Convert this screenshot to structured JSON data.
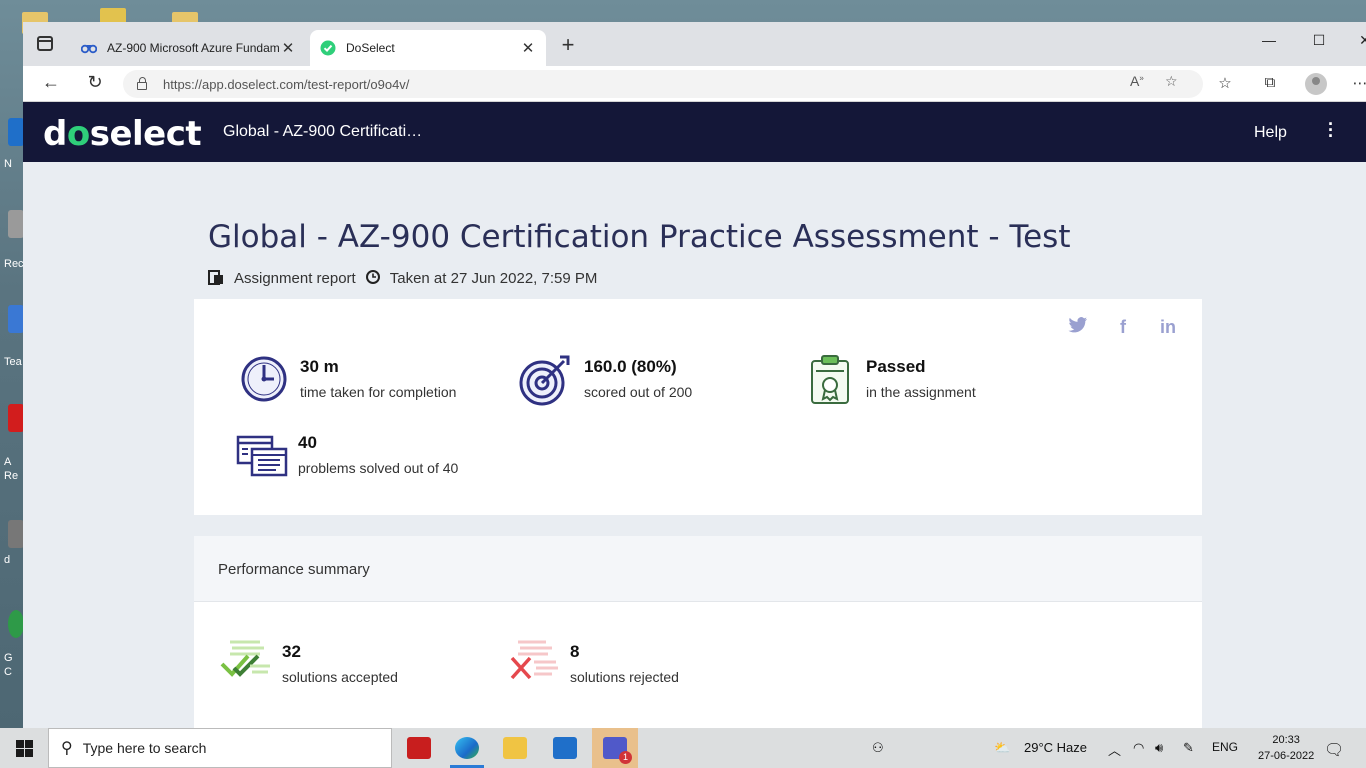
{
  "desktop": {
    "labels": [
      "N",
      "Rec",
      "Tea",
      "A",
      "Re",
      "d",
      "G",
      "C"
    ]
  },
  "browser": {
    "tabs": [
      {
        "title": "AZ-900 Microsoft Azure Fundam",
        "active": false
      },
      {
        "title": "DoSelect",
        "active": true
      }
    ],
    "tab_close": "✕",
    "new_tab": "+",
    "window_controls": {
      "minimize": "—",
      "maximize": "☐",
      "close": "✕"
    },
    "url": "https://app.doselect.com/test-report/o9o4v/"
  },
  "site": {
    "logo_prefix": "d",
    "logo_o": "o",
    "logo_suffix": "select",
    "header_title": "Global - AZ-900 Certificati…",
    "help_label": "Help"
  },
  "report": {
    "title": "Global - AZ-900 Certification Practice Assessment - Test",
    "assignment_label": "Assignment report",
    "taken_at": "Taken at 27 Jun 2022, 7:59 PM",
    "social": {
      "twitter": "twitter-icon",
      "facebook": "f",
      "linkedin": "in"
    },
    "stats": [
      {
        "value": "30 m",
        "desc": "time taken for completion",
        "icon": "clock-icon"
      },
      {
        "value": "160.0 (80%)",
        "desc": "scored out of 200",
        "icon": "target-icon"
      },
      {
        "value": "Passed",
        "desc": "in the assignment",
        "icon": "certificate-icon"
      },
      {
        "value": "40",
        "desc": "problems solved out of 40",
        "icon": "problems-icon"
      }
    ],
    "performance": {
      "heading": "Performance summary",
      "accepted": {
        "value": "32",
        "desc": "solutions accepted"
      },
      "rejected": {
        "value": "8",
        "desc": "solutions rejected"
      }
    }
  },
  "taskbar": {
    "search_placeholder": "Type here to search",
    "weather": "29°C  Haze",
    "language": "ENG",
    "time": "20:33",
    "date": "27-06-2022",
    "teams_badge": "1"
  },
  "colors": {
    "header_bg": "#141738",
    "logo_accent": "#2fcf7a",
    "title_color": "#2a2f57",
    "accepted_green": "#7ac143",
    "rejected_red": "#e5484d"
  }
}
